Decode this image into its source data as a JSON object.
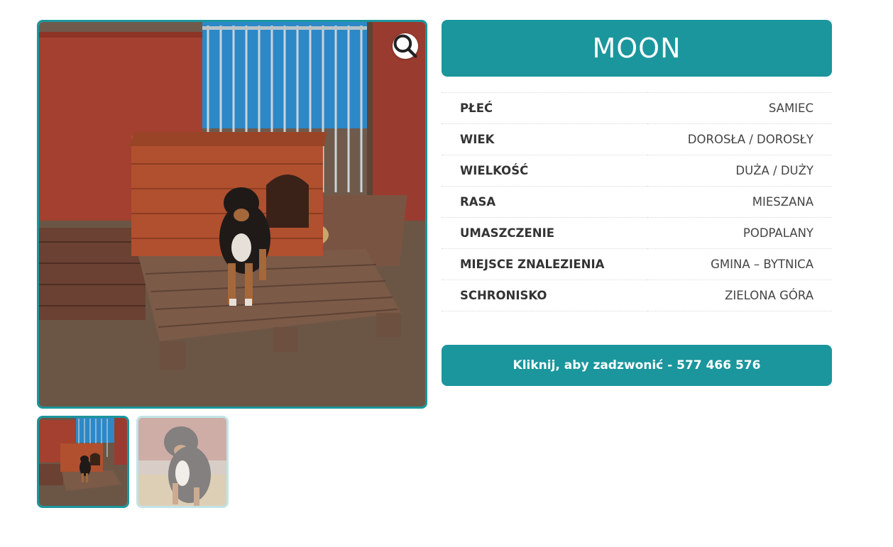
{
  "dog": {
    "name": "MOON"
  },
  "attributes": [
    {
      "label": "PŁEĆ",
      "value": "SAMIEC"
    },
    {
      "label": "WIEK",
      "value": "DOROSŁA / DOROSŁY"
    },
    {
      "label": "WIELKOŚĆ",
      "value": "DUŻA / DUŻY"
    },
    {
      "label": "RASA",
      "value": "MIESZANA"
    },
    {
      "label": "UMASZCZENIE",
      "value": "PODPALANY"
    },
    {
      "label": "MIEJSCE ZNALEZIENIA",
      "value": "GMINA – BYTNICA"
    },
    {
      "label": "SCHRONISKO",
      "value": "ZIELONA GÓRA"
    }
  ],
  "call_button": {
    "label": "Kliknij, aby zadzwonić - 577 466 576"
  },
  "gallery": {
    "zoom_icon": "magnifier-icon",
    "active_thumb": 1,
    "thumb_count": 2
  },
  "colors": {
    "accent": "#1b969d"
  }
}
